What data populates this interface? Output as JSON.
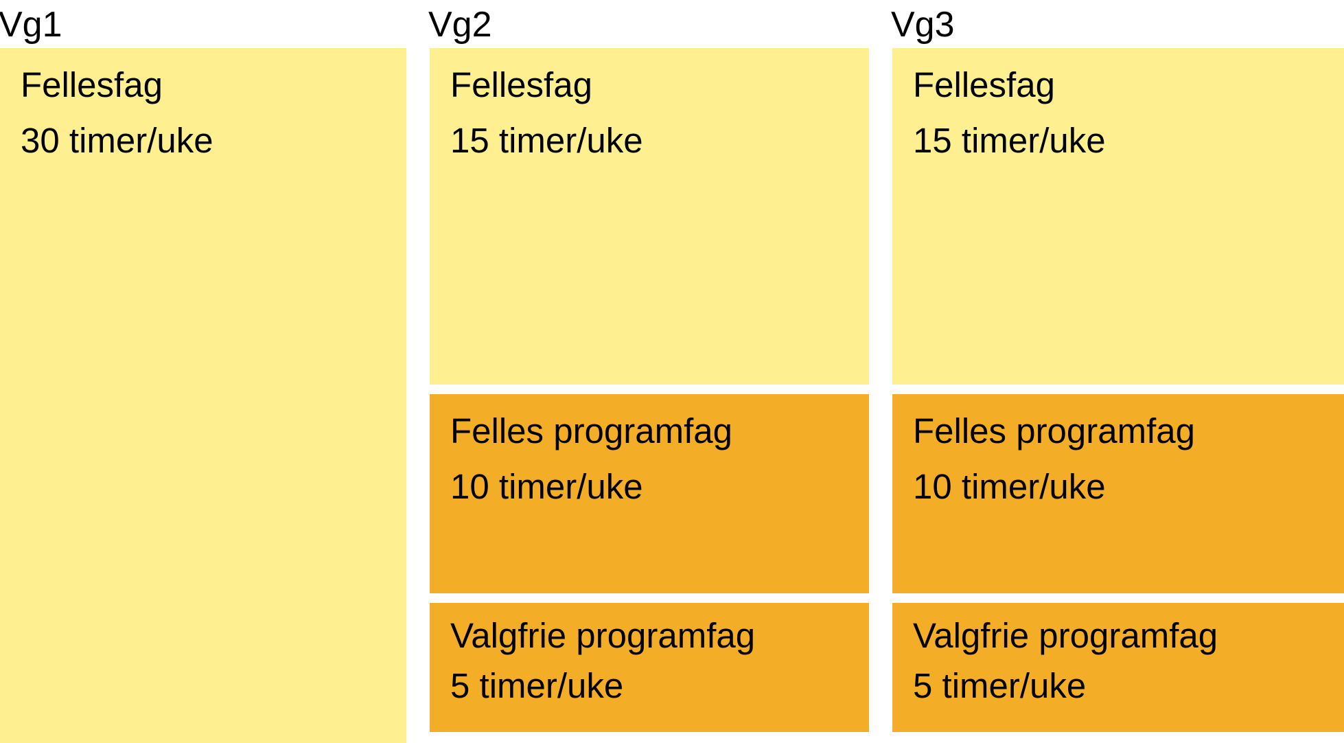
{
  "colors": {
    "light": "#feef90",
    "dark": "#f4ad27"
  },
  "columns": [
    {
      "header": "Vg1",
      "blocks": [
        {
          "title": "Fellesfag",
          "hours": "30 timer/uke",
          "tone": "light",
          "size": "full"
        }
      ]
    },
    {
      "header": "Vg2",
      "blocks": [
        {
          "title": "Fellesfag",
          "hours": "15 timer/uke",
          "tone": "light",
          "size": "tall"
        },
        {
          "title": "Felles programfag",
          "hours": "10 timer/uke",
          "tone": "dark",
          "size": "mid"
        },
        {
          "title": "Valgfrie programfag",
          "hours": "5 timer/uke",
          "tone": "dark",
          "size": "short"
        }
      ]
    },
    {
      "header": "Vg3",
      "blocks": [
        {
          "title": "Fellesfag",
          "hours": "15 timer/uke",
          "tone": "light",
          "size": "tall"
        },
        {
          "title": "Felles programfag",
          "hours": "10 timer/uke",
          "tone": "dark",
          "size": "mid"
        },
        {
          "title": "Valgfrie programfag",
          "hours": "5 timer/uke",
          "tone": "dark",
          "size": "short"
        }
      ]
    }
  ]
}
